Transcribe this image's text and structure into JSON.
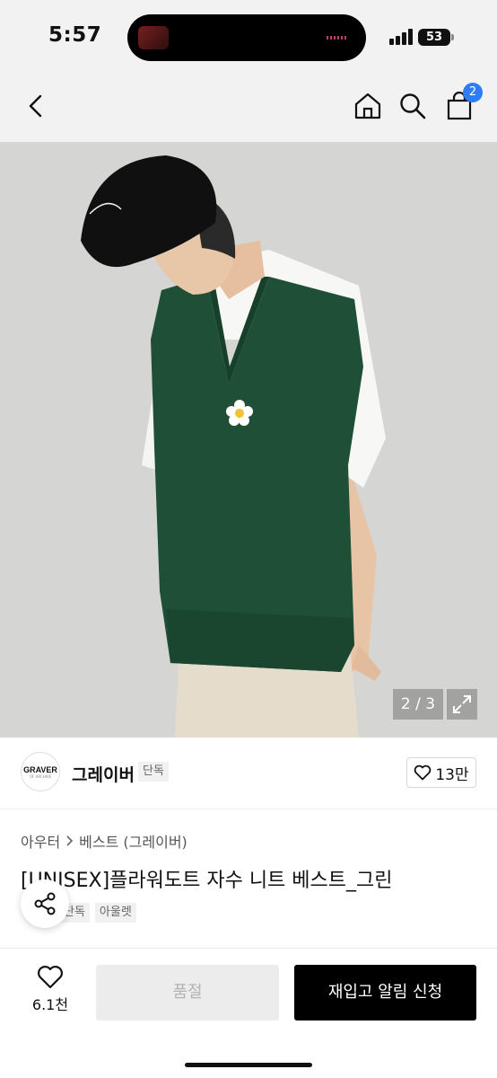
{
  "status": {
    "time": "5:57",
    "battery": "53"
  },
  "header": {
    "cart_badge": "2"
  },
  "hero": {
    "counter": "2 / 3"
  },
  "brand": {
    "logo_text": "GRAVER",
    "logo_subtext": "OF ARCHIVE",
    "name": "그레이버",
    "exclusive_tag": "단독",
    "likes": "13만"
  },
  "product": {
    "breadcrumb": [
      "아우터",
      "베스트 (그레이버)"
    ],
    "title": "[UNISEX]플라워도트 자수 니트 베스트_그린",
    "tags": [
      "단독",
      "아울렛"
    ]
  },
  "bottom_bar": {
    "like_count": "6.1천",
    "soldout_label": "품절",
    "restock_label": "재입고 알림 신청"
  },
  "colors": {
    "accent": "#2f7df6",
    "vest": "#1f4f36",
    "primary_button": "#000000"
  }
}
